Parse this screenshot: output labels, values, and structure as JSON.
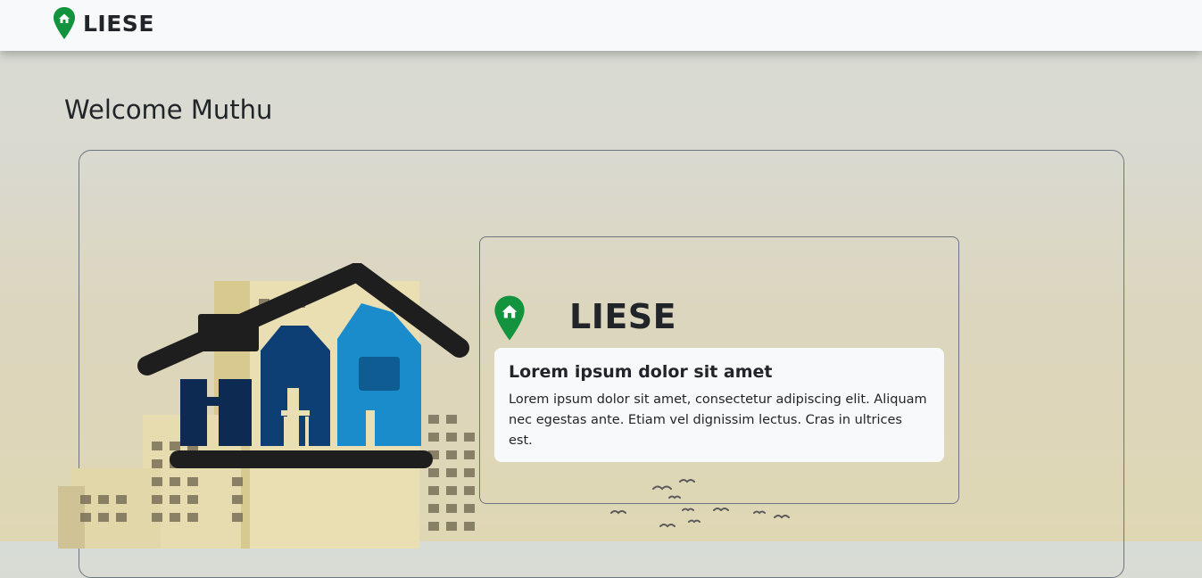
{
  "navbar": {
    "brand": "LIESE"
  },
  "page": {
    "welcome": "Welcome Muthu"
  },
  "card": {
    "brand": "LIESE",
    "info_title": "Lorem ipsum dolor sit amet",
    "info_text": "Lorem ipsum dolor sit amet, consectetur adipiscing elit. Aliquam nec egestas ante. Etiam vel dignissim lectus. Cras in ultrices est."
  },
  "icons": {
    "brand": "map-pin-house-icon",
    "hero": "house-tools-logo",
    "building": "apartment-building-illustration",
    "birds": "birds-decoration"
  },
  "colors": {
    "pin_green": "#13933e",
    "navbar_bg": "#f8f9fa",
    "logo_dark_blue": "#0d2a52",
    "logo_light_blue": "#1a8ccc",
    "roof_dark": "#1e1e1e"
  }
}
